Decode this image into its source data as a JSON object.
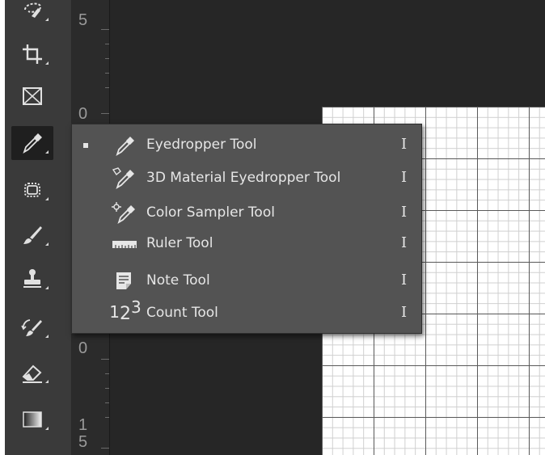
{
  "ruler": {
    "labels": [
      "5",
      "0",
      "0",
      "1",
      "5"
    ]
  },
  "flyout": {
    "items": [
      {
        "label": "Eyedropper Tool",
        "shortcut": "I",
        "icon": "eyedropper-icon",
        "selected": true
      },
      {
        "label": "3D Material Eyedropper Tool",
        "shortcut": "I",
        "icon": "3d-material-eyedropper-icon",
        "selected": false
      },
      {
        "label": "Color Sampler Tool",
        "shortcut": "I",
        "icon": "color-sampler-icon",
        "selected": false
      },
      {
        "label": "Ruler Tool",
        "shortcut": "I",
        "icon": "ruler-icon",
        "selected": false
      },
      {
        "label": "Note Tool",
        "shortcut": "I",
        "icon": "note-icon",
        "selected": false
      },
      {
        "label": "Count Tool",
        "shortcut": "I",
        "icon": "count-icon",
        "selected": false
      }
    ],
    "count_icon_text": {
      "a": "1",
      "b": "2",
      "c": "3"
    }
  },
  "toolbar": {
    "tools": [
      "lasso-icon",
      "crop-icon",
      "frame-icon",
      "eyedropper-icon",
      "spot-healing-icon",
      "brush-icon",
      "clone-stamp-icon",
      "history-brush-icon",
      "eraser-icon",
      "gradient-icon"
    ]
  },
  "colors": {
    "app_background": "#262626",
    "toolbar": "#3a3a3a",
    "menu": "#535353",
    "menu_text": "#e6e6e6"
  }
}
